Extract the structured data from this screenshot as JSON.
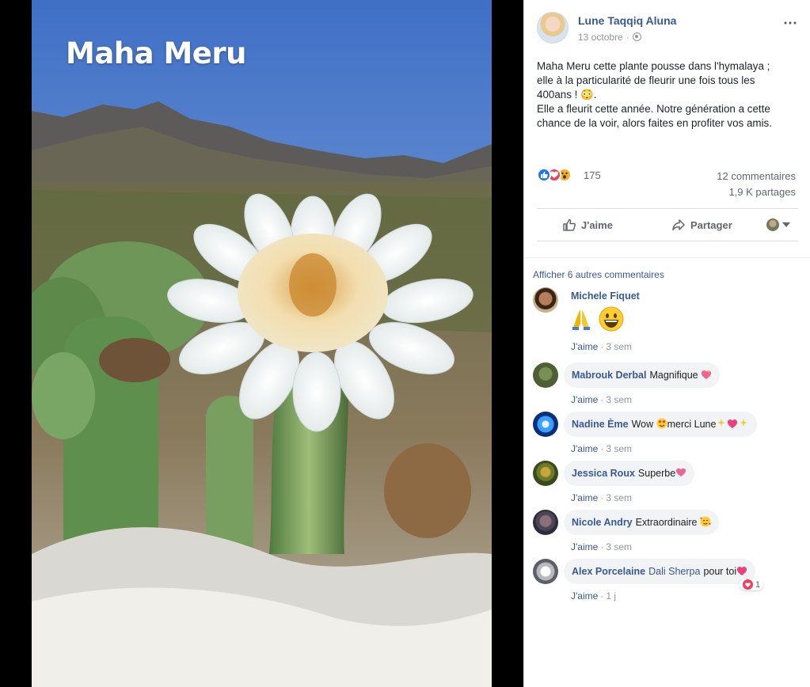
{
  "photo": {
    "caption": "Maha Meru"
  },
  "post": {
    "author": "Lune Taqqiq Aluna",
    "date": "13 octobre",
    "more_icon": "⋯",
    "text_line1": "Maha Meru cette plante pousse dans l'hymalaya ;",
    "text_line2": "elle à la particularité de fleurir une fois tous les",
    "text_line3": "400ans ! 😳.",
    "text_line4": "Elle a fleurit cette année. Notre génération a cette",
    "text_line5": "chance de la voir, alors faites en profiter vos amis.",
    "reaction_count": "175",
    "comments_count": "12 commentaires",
    "shares_count": "1,9 K partages",
    "like_label": "J'aime",
    "share_label": "Partager",
    "icons": [
      "globe-icon",
      "like-reaction-icon",
      "love-reaction-icon",
      "wow-reaction-icon",
      "thumb-icon",
      "share-icon",
      "caret-icon"
    ]
  },
  "comments": {
    "more_label": "Afficher 6 autres commentaires",
    "items": [
      {
        "name": "Michele Fiquet",
        "text": "",
        "like": "J'aime",
        "time": "3 sem"
      },
      {
        "name": "Mabrouk Derbal",
        "text": "Magnifique",
        "like": "J'aime",
        "time": "3 sem"
      },
      {
        "name": "Nadine Ème",
        "text": "Wow",
        "text2": "merci Lune",
        "like": "J'aime",
        "time": "3 sem"
      },
      {
        "name": "Jessica Roux",
        "text": "Superbe",
        "like": "J'aime",
        "time": "3 sem"
      },
      {
        "name": "Nicole Andry",
        "text": "Extraordinaire",
        "like": "J'aime",
        "time": "3 sem"
      },
      {
        "name": "Alex Porcelaine",
        "tag": "Dali Sherpa",
        "text": "pour toi",
        "like": "J'aime",
        "time": "1 j",
        "reaction_count": "1"
      }
    ]
  }
}
